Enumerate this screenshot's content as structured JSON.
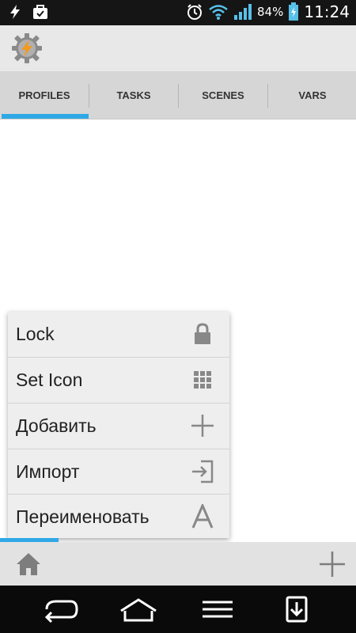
{
  "status_bar": {
    "battery_percent": "84%",
    "time": "11:24",
    "icons": [
      "flash-icon",
      "briefcase-check-icon",
      "alarm-icon",
      "wifi-icon",
      "signal-icon",
      "battery-charging-icon"
    ]
  },
  "app_bar": {
    "logo_icon": "tasker-gear-bolt-icon"
  },
  "tabs": [
    {
      "label": "PROFILES",
      "selected": true
    },
    {
      "label": "TASKS",
      "selected": false
    },
    {
      "label": "SCENES",
      "selected": false
    },
    {
      "label": "VARS",
      "selected": false
    }
  ],
  "menu": {
    "items": [
      {
        "label": "Lock",
        "icon": "lock-icon"
      },
      {
        "label": "Set Icon",
        "icon": "grid-icon"
      },
      {
        "label": "Добавить",
        "icon": "plus-icon"
      },
      {
        "label": "Импорт",
        "icon": "import-icon"
      },
      {
        "label": "Переименовать",
        "icon": "letter-a-icon"
      }
    ]
  },
  "bottom_bar": {
    "left_icon": "home-icon",
    "right_icon": "add-icon"
  },
  "nav_bar": {
    "buttons": [
      "back-icon",
      "home-nav-icon",
      "menu-icon",
      "download-icon"
    ]
  },
  "colors": {
    "accent": "#2fa8e6",
    "status_bar": "#151515",
    "nav_bar": "#0a0a0a",
    "tab_bg": "#d6d6d6",
    "menu_bg": "#eeeeee"
  }
}
